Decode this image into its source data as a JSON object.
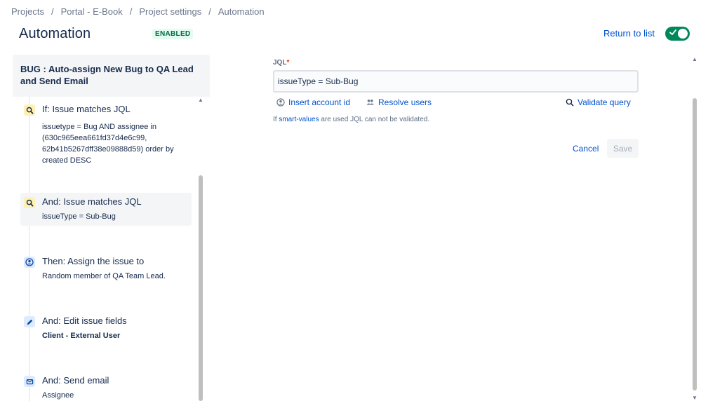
{
  "breadcrumb": {
    "items": [
      "Projects",
      "Portal - E-Book",
      "Project settings",
      "Automation"
    ],
    "separator": "/"
  },
  "header": {
    "title": "Automation",
    "status_badge": "ENABLED",
    "return_link": "Return to list",
    "toggle_state": "on"
  },
  "rule": {
    "name": "BUG : Auto-assign New Bug to QA Lead and Send Email",
    "components": [
      {
        "icon": "search-icon",
        "type": "condition",
        "title": "If: Issue matches JQL",
        "detail": "issuetype = Bug AND assignee in (630c965eea661fd37d4e6c99, 62b41b5267dff38e09888d59) order by created DESC"
      },
      {
        "icon": "search-icon",
        "type": "condition",
        "title": "And: Issue matches JQL",
        "detail": "issueType = Sub-Bug",
        "selected": true
      },
      {
        "icon": "assign-user-icon",
        "type": "action",
        "title": "Then: Assign the issue to",
        "detail": "Random member of QA Team Lead."
      },
      {
        "icon": "pencil-icon",
        "type": "action",
        "title": "And: Edit issue fields",
        "detail": "Client - External User"
      },
      {
        "icon": "mail-icon",
        "type": "action",
        "title": "And: Send email",
        "detail": "Assignee"
      }
    ]
  },
  "editor": {
    "jql_label": "JQL",
    "required_mark": "*",
    "jql_value": "issueType = Sub-Bug",
    "insert_account_label": "Insert account id",
    "resolve_users_label": "Resolve users",
    "validate_query_label": "Validate query",
    "hint_prefix": "If ",
    "hint_link": "smart-values",
    "hint_suffix": " are used JQL can not be validated.",
    "cancel_label": "Cancel",
    "save_label": "Save"
  },
  "colors": {
    "link": "#0052cc",
    "toggle_on": "#00875a",
    "badge_bg": "#e3fcef",
    "badge_text": "#006644",
    "condition_icon_bg": "#fff0b3",
    "action_icon_bg": "#deebff"
  }
}
